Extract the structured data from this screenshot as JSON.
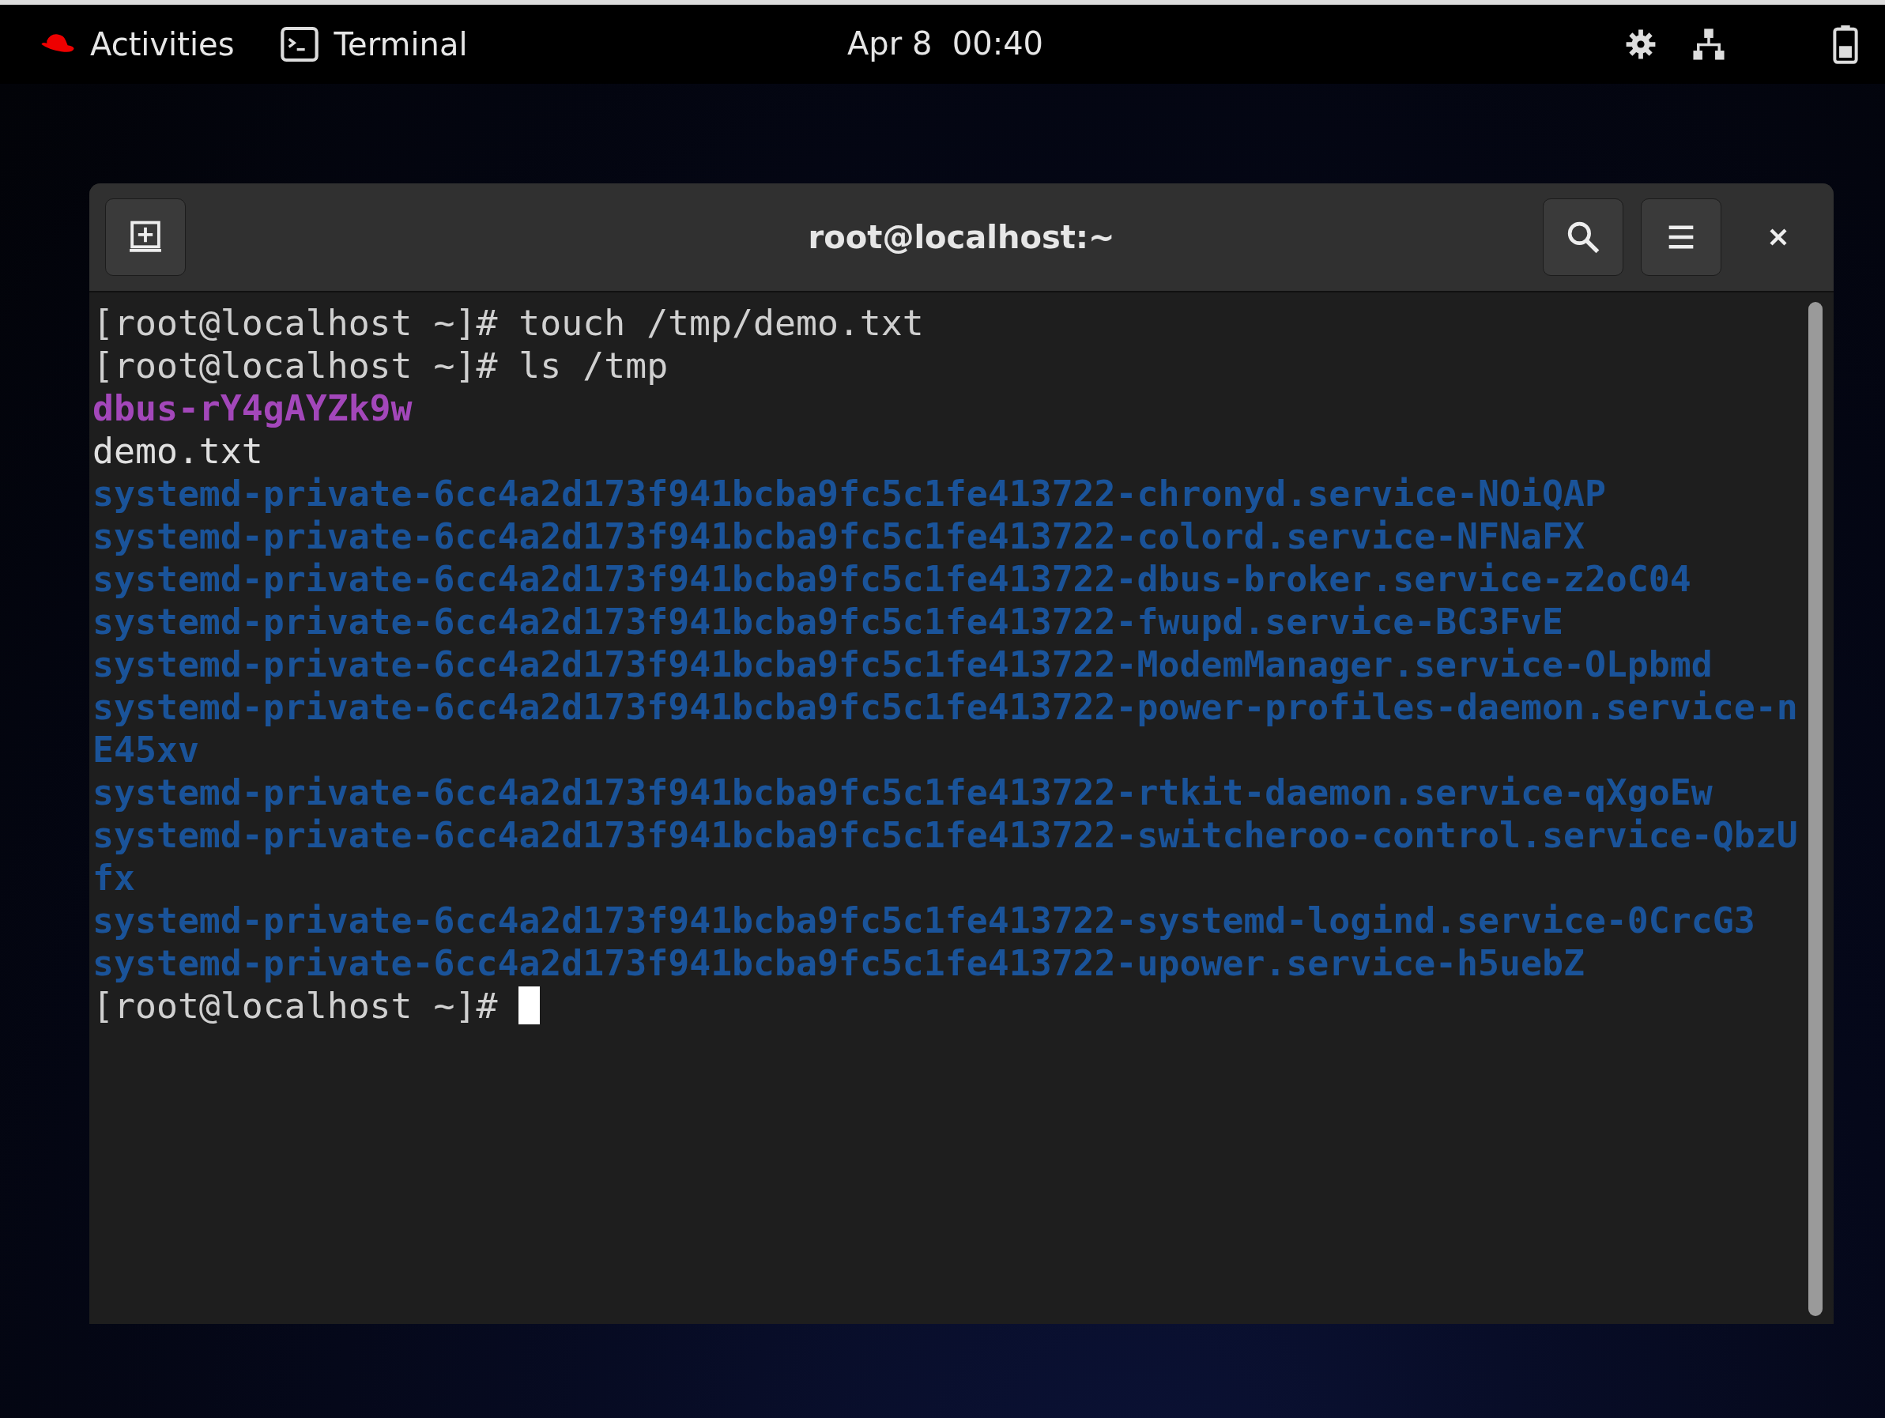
{
  "top_bar": {
    "activities": "Activities",
    "app": "Terminal",
    "clock": "Apr 8  00:40"
  },
  "window": {
    "title": "root@localhost:~"
  },
  "terminal": {
    "lines": [
      {
        "kind": "prompt",
        "prompt": "[root@localhost ~]#",
        "command": "touch /tmp/demo.txt"
      },
      {
        "kind": "prompt",
        "prompt": "[root@localhost ~]#",
        "command": "ls /tmp"
      },
      {
        "kind": "socket",
        "text": "dbus-rY4gAYZk9w"
      },
      {
        "kind": "file",
        "text": "demo.txt"
      },
      {
        "kind": "directory",
        "text": "systemd-private-6cc4a2d173f941bcba9fc5c1fe413722-chronyd.service-NOiQAP"
      },
      {
        "kind": "directory",
        "text": "systemd-private-6cc4a2d173f941bcba9fc5c1fe413722-colord.service-NFNaFX"
      },
      {
        "kind": "directory",
        "text": "systemd-private-6cc4a2d173f941bcba9fc5c1fe413722-dbus-broker.service-z2oC04"
      },
      {
        "kind": "directory",
        "text": "systemd-private-6cc4a2d173f941bcba9fc5c1fe413722-fwupd.service-BC3FvE"
      },
      {
        "kind": "directory",
        "text": "systemd-private-6cc4a2d173f941bcba9fc5c1fe413722-ModemManager.service-OLpbmd"
      },
      {
        "kind": "directory",
        "text": "systemd-private-6cc4a2d173f941bcba9fc5c1fe413722-power-profiles-daemon.service-nE45xv"
      },
      {
        "kind": "directory",
        "text": "systemd-private-6cc4a2d173f941bcba9fc5c1fe413722-rtkit-daemon.service-qXgoEw"
      },
      {
        "kind": "directory",
        "text": "systemd-private-6cc4a2d173f941bcba9fc5c1fe413722-switcheroo-control.service-QbzUfx"
      },
      {
        "kind": "directory",
        "text": "systemd-private-6cc4a2d173f941bcba9fc5c1fe413722-systemd-logind.service-0CrcG3"
      },
      {
        "kind": "directory",
        "text": "systemd-private-6cc4a2d173f941bcba9fc5c1fe413722-upower.service-h5uebZ"
      },
      {
        "kind": "prompt",
        "prompt": "[root@localhost ~]#",
        "cursor": true
      }
    ]
  }
}
